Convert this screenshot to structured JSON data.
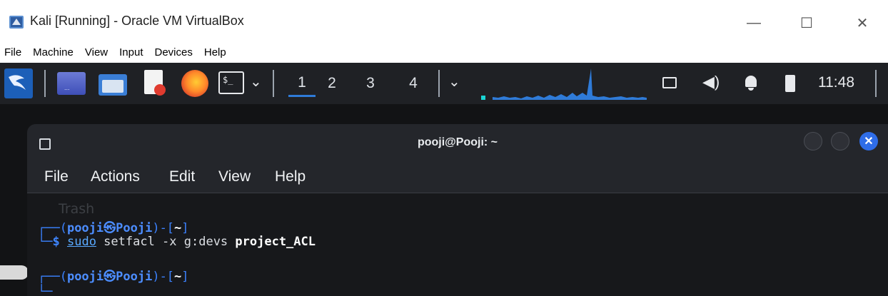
{
  "host_window": {
    "title": "Kali [Running] - Oracle VM VirtualBox",
    "controls": {
      "minimize": "—",
      "maximize": "☐",
      "close": "✕"
    }
  },
  "vbox_menu": [
    "File",
    "Machine",
    "View",
    "Input",
    "Devices",
    "Help"
  ],
  "kali_panel": {
    "workspaces": [
      "1",
      "2",
      "3",
      "4"
    ],
    "active_workspace": "1",
    "time": "11:48",
    "icons": [
      "kali-menu-icon",
      "desktop-icon",
      "file-manager-icon",
      "text-editor-icon",
      "firefox-icon",
      "terminal-icon",
      "chevron-down-icon",
      "network-icon",
      "volume-icon",
      "notification-bell-icon",
      "battery-icon"
    ]
  },
  "desktop": {
    "trash_label": "Trash"
  },
  "terminal": {
    "title": "pooji@Pooji: ~",
    "menu": [
      "File",
      "Actions",
      "Edit",
      "View",
      "Help"
    ],
    "prompt1": {
      "open": "┌──(",
      "user": "pooji",
      "at": "㉿",
      "host": "Pooji",
      "close": ")-[",
      "dir": "~",
      "end": "]"
    },
    "command1": {
      "prefix": "└─",
      "dollar": "$",
      "sudo": "sudo",
      "cmd": " setfacl -x g:devs ",
      "target": "project_ACL"
    },
    "prompt2": {
      "open": "┌──(",
      "user": "pooji",
      "at": "㉿",
      "host": "Pooji",
      "close": ")-[",
      "dir": "~",
      "end": "]"
    }
  }
}
